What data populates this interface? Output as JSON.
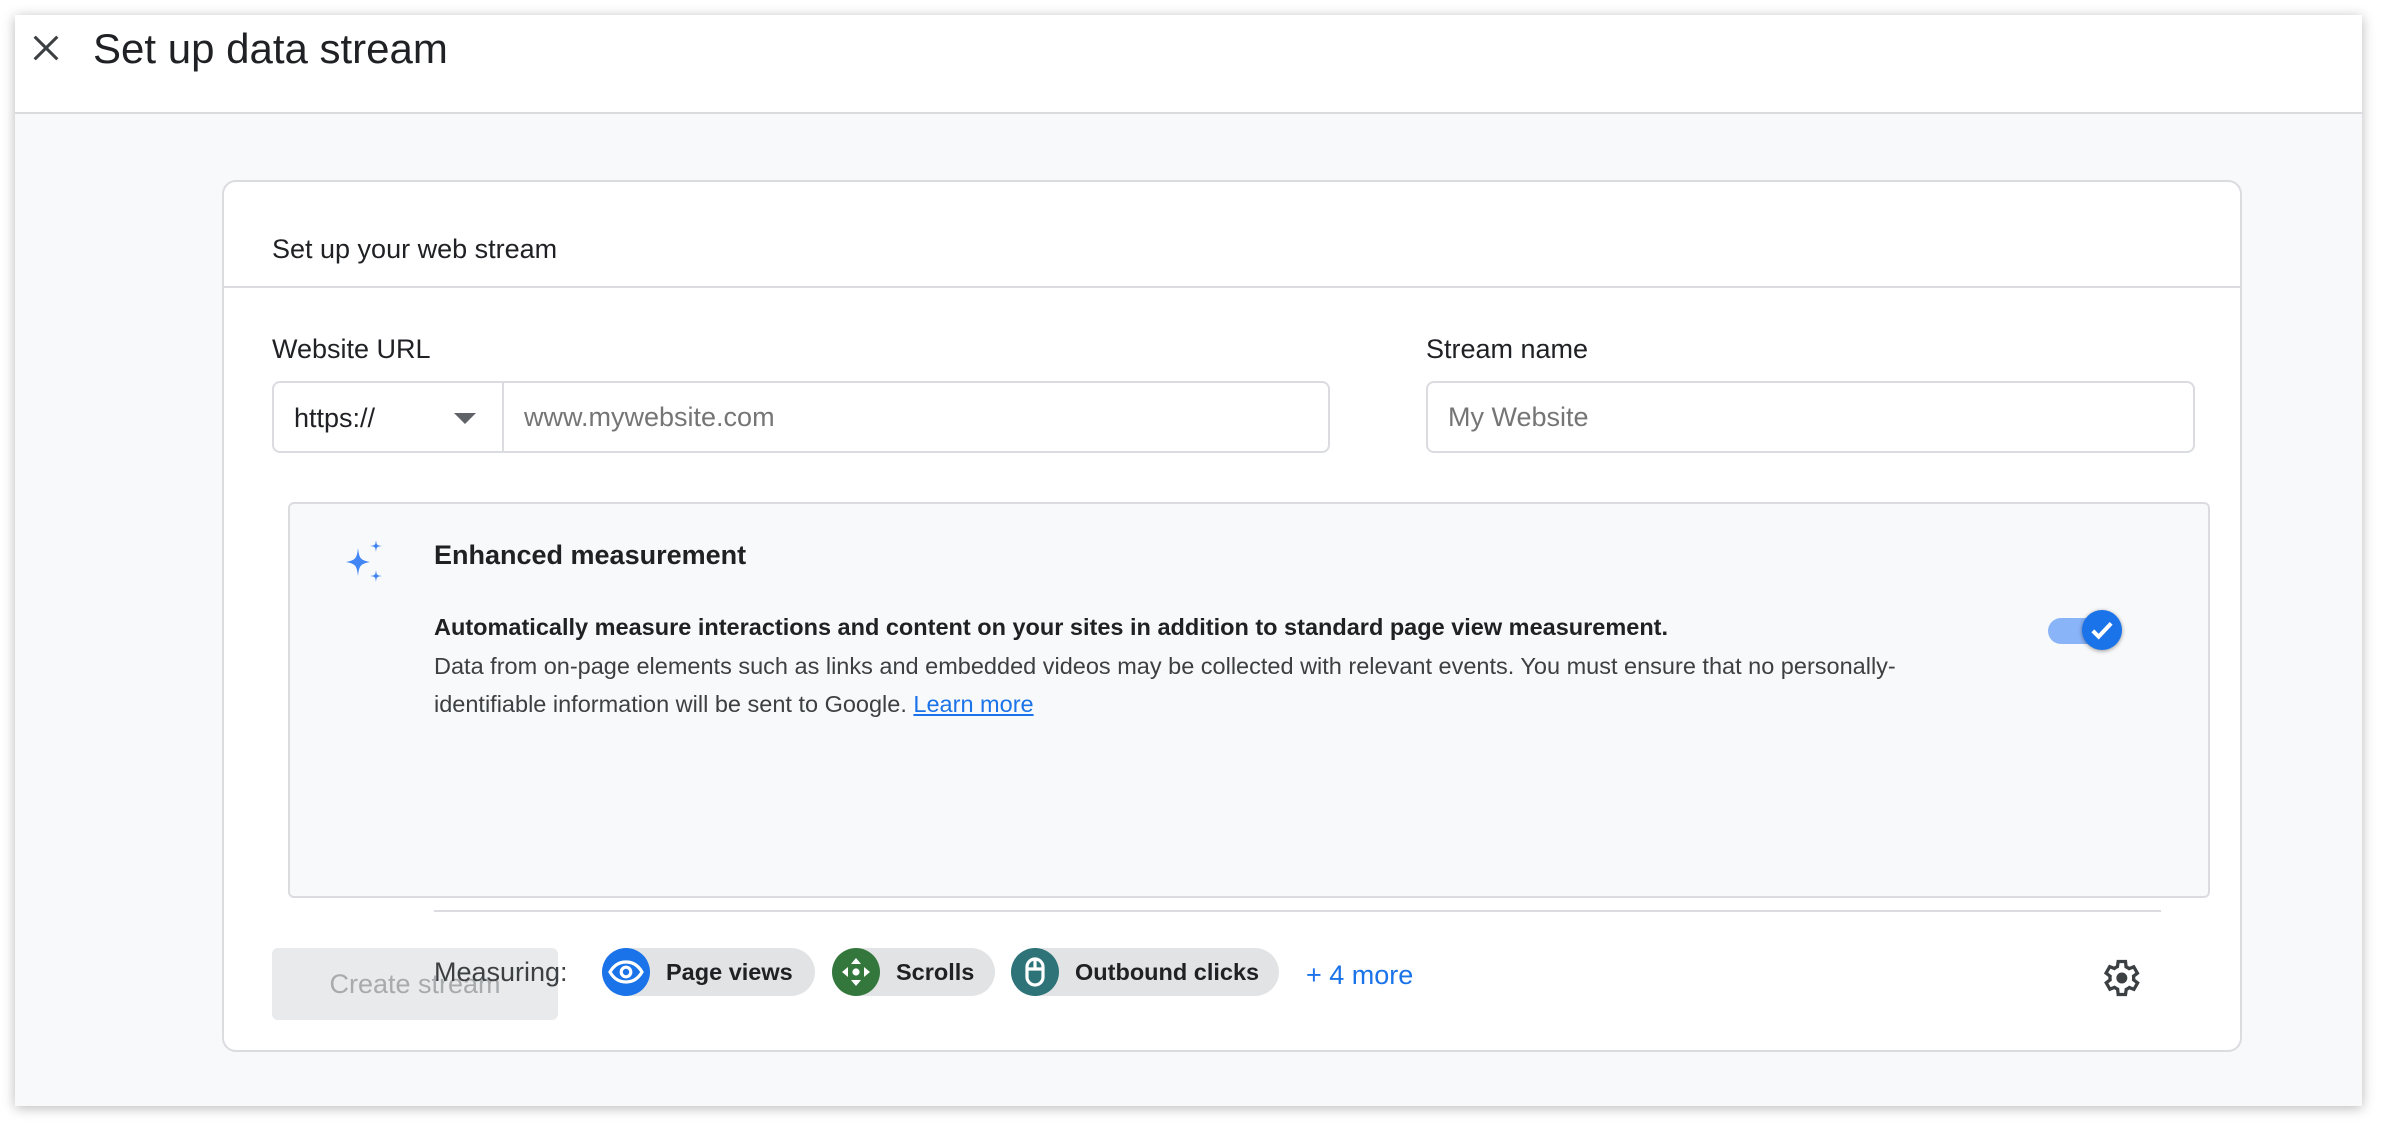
{
  "header": {
    "title": "Set up data stream",
    "close_icon": "close-icon"
  },
  "card": {
    "title": "Set up your web stream",
    "website_url": {
      "label": "Website URL",
      "protocol": "https://",
      "placeholder": "www.mywebsite.com"
    },
    "stream_name": {
      "label": "Stream name",
      "placeholder": "My Website"
    },
    "enhanced": {
      "title": "Enhanced measurement",
      "description_bold": "Automatically measure interactions and content on your sites in addition to standard page view measurement.",
      "description": "Data from on-page elements such as links and embedded videos may be collected with relevant events. You must ensure that no personally-identifiable information will be sent to Google. ",
      "learn_more": "Learn more",
      "toggle_on": true,
      "measuring_label": "Measuring:",
      "chips": [
        {
          "label": "Page views",
          "icon": "eye-icon",
          "color": "#1a73e8"
        },
        {
          "label": "Scrolls",
          "icon": "scroll-icon",
          "color": "#34773c"
        },
        {
          "label": "Outbound clicks",
          "icon": "mouse-icon",
          "color": "#2e7378"
        }
      ],
      "more": "+ 4 more"
    },
    "create_button": "Create stream"
  }
}
